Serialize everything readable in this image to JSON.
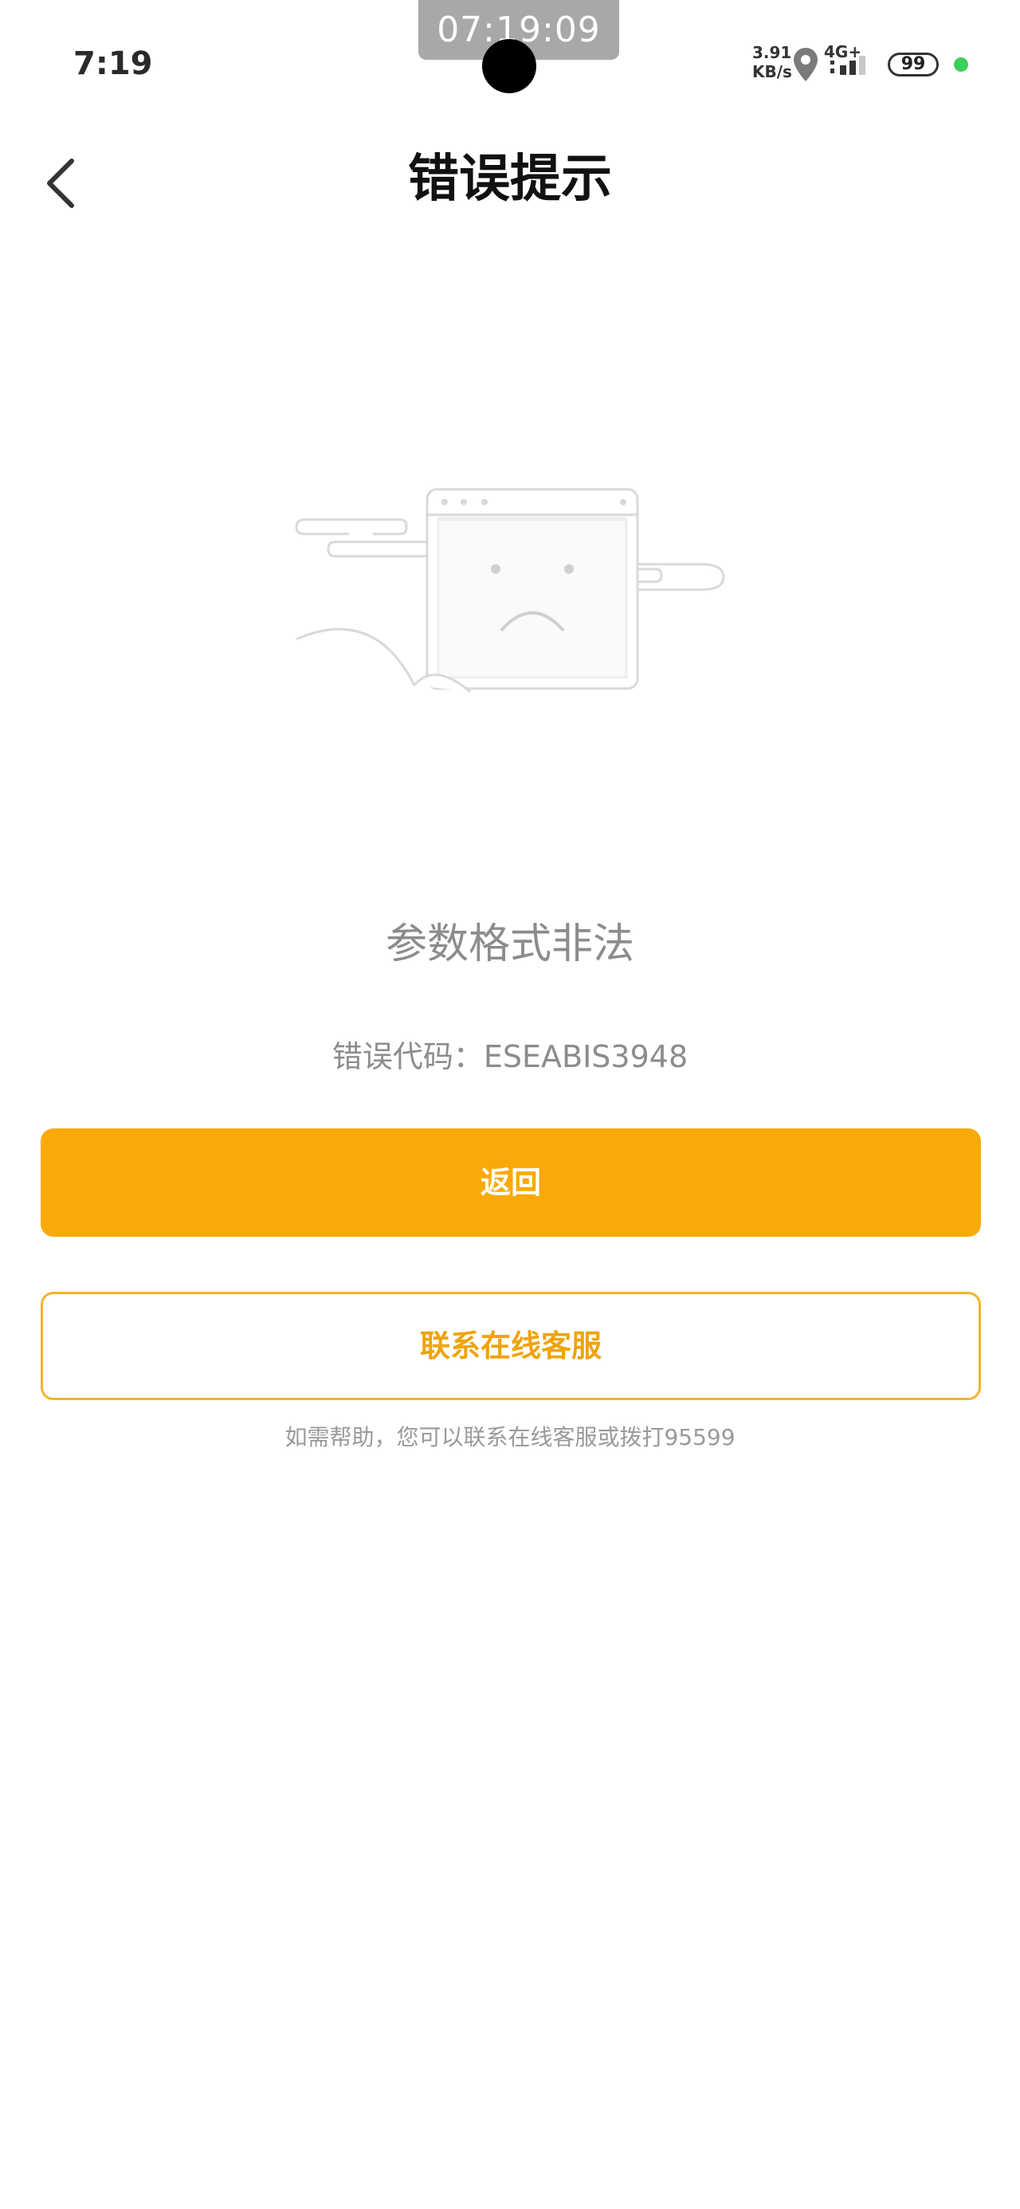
{
  "recording": {
    "timestamp": "07:19:09"
  },
  "status_bar": {
    "time": "7:19",
    "speed_value": "3.91",
    "speed_unit": "KB/s",
    "network": "4G+",
    "battery": "99",
    "icons": [
      "location-icon",
      "signal-icon",
      "battery-icon",
      "privacy-dot-icon"
    ],
    "dot_color": "#3ccf5a"
  },
  "nav": {
    "back_icon": "chevron-left-icon",
    "title": "错误提示"
  },
  "illustration": {
    "icon": "sad-browser-window-icon"
  },
  "error": {
    "message": "参数格式非法",
    "code": "错误代码：ESEABIS3948"
  },
  "actions": {
    "back_label": "返回",
    "contact_label": "联系在线客服"
  },
  "help": {
    "text": "如需帮助，您可以联系在线客服或拨打95599"
  },
  "colors": {
    "accent": "#f9aa09",
    "accent_text": "#f0a30c",
    "muted_text": "#8c8c8c"
  }
}
